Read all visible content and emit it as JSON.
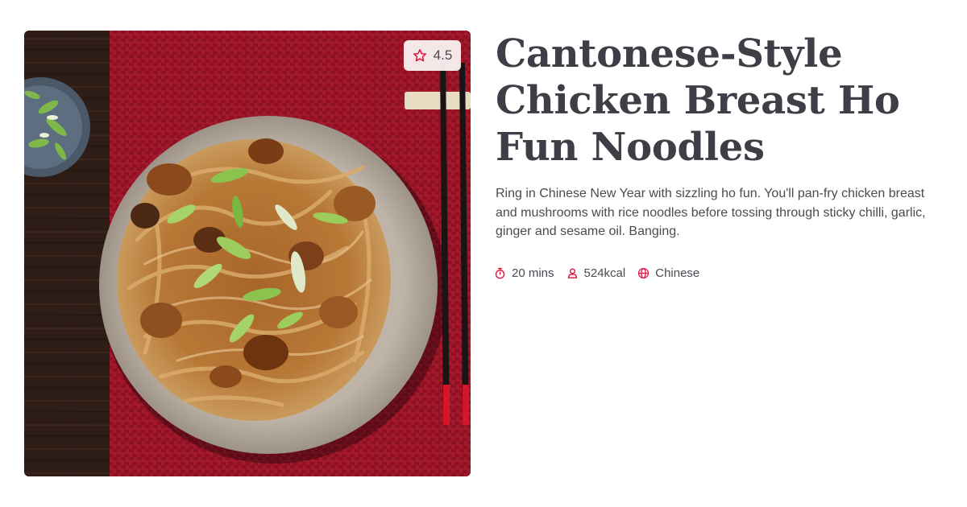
{
  "recipe": {
    "title": "Cantonese-Style Chicken Breast Ho Fun Noodles",
    "description": "Ring in Chinese New Year with sizzling ho fun. You'll pan-fry chicken breast and mushrooms with rice noodles before tossing through sticky chilli, garlic, ginger and sesame oil. Banging.",
    "rating": "4.5",
    "image_subject": "bowl of ho fun noodles with chicken, mushrooms and spring onion on a red woven mat with chopsticks",
    "meta": {
      "time": "20 mins",
      "calories": "524kcal",
      "cuisine": "Chinese"
    }
  },
  "icons": {
    "rating": "star-icon",
    "time": "stopwatch-icon",
    "calories": "person-icon",
    "cuisine": "globe-icon"
  },
  "colors": {
    "accent": "#e0123c",
    "title": "#3e3e46",
    "body_text": "#4a4a52",
    "mat_red": "#a3172a",
    "badge_bg": "#faf4f4"
  }
}
